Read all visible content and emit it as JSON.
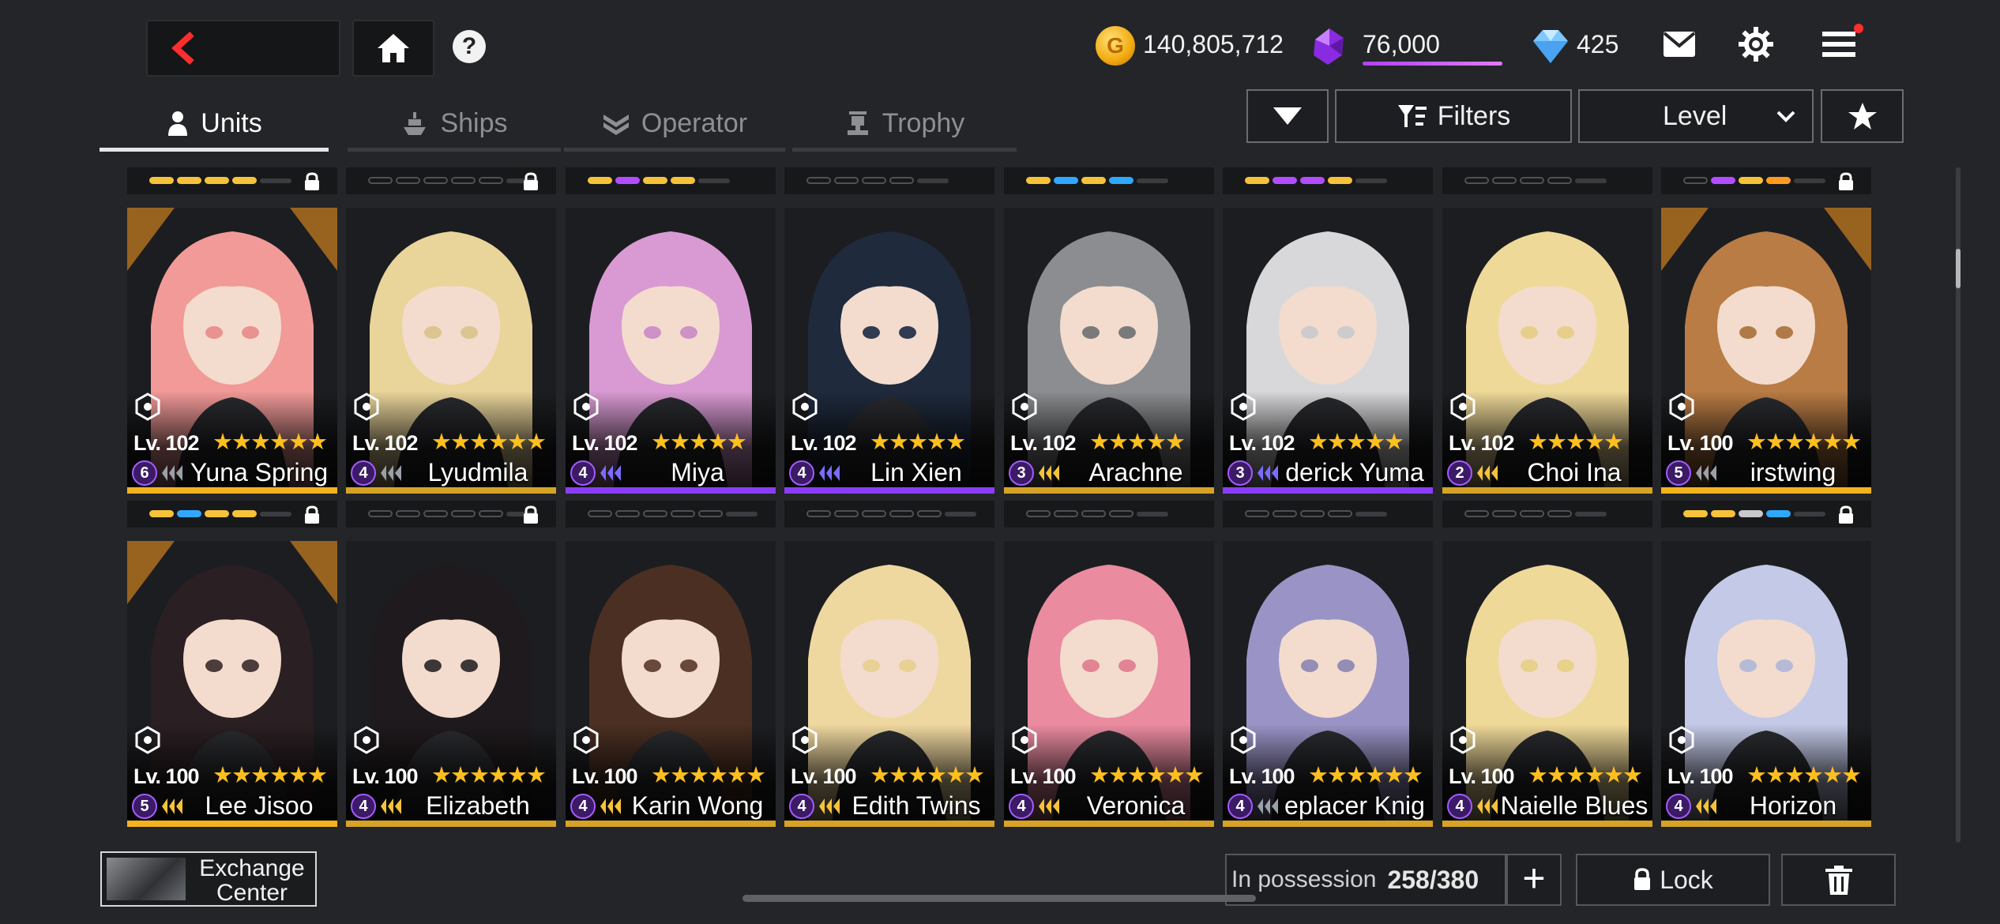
{
  "header": {
    "gold": "140,805,712",
    "crystal": "76,000",
    "gems": "425",
    "help_label": "?",
    "coin_symbol": "G",
    "icons": [
      "back-arrow-icon",
      "home-icon",
      "help-icon",
      "mail-icon",
      "gear-icon",
      "menu-icon"
    ]
  },
  "tabs": [
    {
      "label": "Units",
      "active": true
    },
    {
      "label": "Ships",
      "active": false
    },
    {
      "label": "Operator",
      "active": false
    },
    {
      "label": "Trophy",
      "active": false
    }
  ],
  "controls": {
    "filters_label": "Filters",
    "sort_label": "Level"
  },
  "units": [
    {
      "level": "Lv. 102",
      "name": "Yuna Spring",
      "badge": "6",
      "stars": "★★★★★★",
      "pips": [
        "#f5c23a",
        "#f5c23a",
        "#f5c23a",
        "#f5c23a"
      ],
      "locked": true,
      "color": "#e98a8a",
      "hair": "#f19a98",
      "rank": "#9aa0a8",
      "glow": "#ff9a1f"
    },
    {
      "level": "Lv. 102",
      "name": "Lyudmila",
      "badge": "4",
      "stars": "★★★★★★",
      "pips": [
        "",
        "",
        "",
        "",
        ""
      ],
      "locked": true,
      "color": "#d9c28a",
      "hair": "#e9d49a",
      "rank": "#9aa0a8",
      "glow": ""
    },
    {
      "level": "Lv. 102",
      "name": "Miya",
      "badge": "4",
      "stars": "★★★★★",
      "pips": [
        "#f5c23a",
        "#b34cff",
        "#f5c23a",
        "#f5c23a"
      ],
      "locked": false,
      "color": "#c98ac7",
      "hair": "#d99ad3",
      "rank": "#7b6cff",
      "glow": ""
    },
    {
      "level": "Lv. 102",
      "name": "Lin Xien",
      "badge": "4",
      "stars": "★★★★★",
      "pips": [
        "",
        "",
        "",
        ""
      ],
      "locked": false,
      "color": "#1b2a44",
      "hair": "#1f2a3c",
      "rank": "#7b6cff",
      "glow": ""
    },
    {
      "level": "Lv. 102",
      "name": "Arachne",
      "badge": "3",
      "stars": "★★★★★",
      "pips": [
        "#f5c23a",
        "#2fa8ff",
        "#f5c23a",
        "#2fa8ff"
      ],
      "locked": false,
      "color": "#6d6f72",
      "hair": "#8b8d90",
      "rank": "#f5c23a",
      "glow": ""
    },
    {
      "level": "Lv. 102",
      "name": "derick Yuma",
      "badge": "3",
      "stars": "★★★★★",
      "pips": [
        "#f5c23a",
        "#b34cff",
        "#b34cff",
        "#f5c23a"
      ],
      "locked": false,
      "color": "#c9c9cc",
      "hair": "#d8d8da",
      "rank": "#7b6cff",
      "glow": ""
    },
    {
      "level": "Lv. 102",
      "name": "Choi Ina",
      "badge": "2",
      "stars": "★★★★★",
      "pips": [
        "",
        "",
        "",
        ""
      ],
      "locked": false,
      "color": "#e6cc84",
      "hair": "#efd999",
      "rank": "#f5c23a",
      "glow": ""
    },
    {
      "level": "Lv. 100",
      "name": "irstwing",
      "badge": "5",
      "stars": "★★★★★★",
      "pips": [
        "",
        "#b34cff",
        "#f5c23a",
        "#ff9a1f"
      ],
      "locked": true,
      "color": "#a96f3a",
      "hair": "#b97c45",
      "rank": "#9aa0a8",
      "glow": "#ff9a1f"
    },
    {
      "level": "Lv. 100",
      "name": "Lee Jisoo",
      "badge": "5",
      "stars": "★★★★★★",
      "pips": [
        "#f5c23a",
        "#2fa8ff",
        "#f5c23a",
        "#f5c23a"
      ],
      "locked": true,
      "color": "#3a2a2c",
      "hair": "#2a1f22",
      "rank": "#f5c23a",
      "glow": "#ff9a1f"
    },
    {
      "level": "Lv. 100",
      "name": "Elizabeth",
      "badge": "4",
      "stars": "★★★★★★",
      "pips": [
        "",
        "",
        "",
        "",
        ""
      ],
      "locked": true,
      "color": "#2a2528",
      "hair": "#1f1a1d",
      "rank": "#f5c23a",
      "glow": ""
    },
    {
      "level": "Lv. 100",
      "name": "Karin Wong",
      "badge": "4",
      "stars": "★★★★★★",
      "pips": [
        "",
        "",
        "",
        "",
        ""
      ],
      "locked": false,
      "color": "#5a3a2a",
      "hair": "#4a2f22",
      "rank": "#f5c23a",
      "glow": ""
    },
    {
      "level": "Lv. 100",
      "name": "Edith Twins",
      "badge": "4",
      "stars": "★★★★★★",
      "pips": [
        "",
        "",
        "",
        "",
        ""
      ],
      "locked": false,
      "color": "#e6cf8e",
      "hair": "#efd8a0",
      "rank": "#f5c23a",
      "glow": ""
    },
    {
      "level": "Lv. 100",
      "name": "Veronica",
      "badge": "4",
      "stars": "★★★★★★",
      "pips": [
        "",
        "",
        "",
        ""
      ],
      "locked": false,
      "color": "#e07a8e",
      "hair": "#ea8ba0",
      "rank": "#f5c23a",
      "glow": ""
    },
    {
      "level": "Lv. 100",
      "name": "eplacer Knig",
      "badge": "4",
      "stars": "★★★★★★",
      "pips": [
        "",
        "",
        "",
        ""
      ],
      "locked": false,
      "color": "#8a84b4",
      "hair": "#9a94c6",
      "rank": "#9aa0a8",
      "glow": ""
    },
    {
      "level": "Lv. 100",
      "name": "Naielle Blues",
      "badge": "4",
      "stars": "★★★★★★",
      "pips": [
        "",
        "",
        "",
        ""
      ],
      "locked": false,
      "color": "#e6cf84",
      "hair": "#efd999",
      "rank": "#f5c23a",
      "glow": ""
    },
    {
      "level": "Lv. 100",
      "name": "Horizon",
      "badge": "4",
      "stars": "★★★★★★",
      "pips": [
        "#f5c23a",
        "#f5c23a",
        "#c9c9cc",
        "#2fa8ff"
      ],
      "locked": true,
      "color": "#aeb6d8",
      "hair": "#c3c9e6",
      "rank": "#f5c23a",
      "glow": ""
    }
  ],
  "bottom": {
    "exchange_line1": "Exchange",
    "exchange_line2": "Center",
    "possession_label": "In possession",
    "possession_value": "258/380",
    "plus_label": "+",
    "lock_label": "Lock"
  },
  "colors": {
    "accent_purple": "#b13fff",
    "star_gold": "#ffbf1f",
    "rarity_gold": "#f5c23a",
    "rarity_purple": "#b34cff",
    "rarity_blue": "#2fa8ff"
  }
}
